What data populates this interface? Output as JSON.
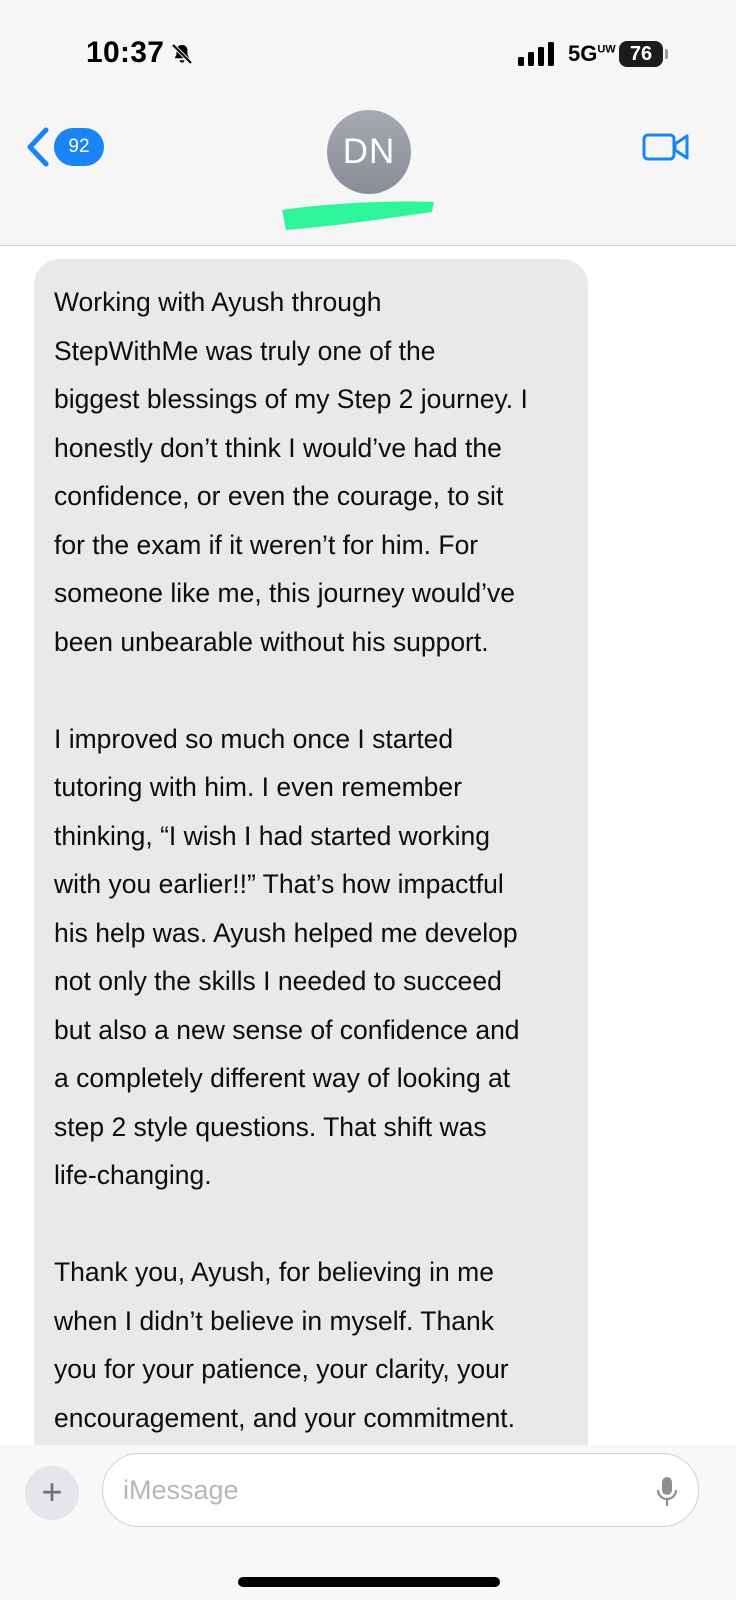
{
  "status_bar": {
    "time": "10:37",
    "network": "5G",
    "network_sup": "UW",
    "battery": "76"
  },
  "header": {
    "back_count": "92",
    "contact_initials": "DN"
  },
  "message": {
    "lines": [
      "Working with Ayush through",
      "StepWithMe was truly one of the",
      "biggest blessings of my Step 2 journey. I",
      "honestly don’t think I would’ve had the",
      "confidence, or even the courage, to sit",
      "for the exam if it weren’t for him. For",
      "someone like me, this journey would’ve",
      "been unbearable without his support.",
      "",
      "I improved so much once I started",
      "tutoring with him. I even remember",
      "thinking, “I wish I had started working",
      "with you earlier!!” That’s how impactful",
      "his help was. Ayush helped me develop",
      "not only the skills I needed to succeed",
      "but also a new sense of confidence and",
      "a completely different way of looking at",
      "step 2 style questions. That shift was",
      "life-changing.",
      "",
      "Thank you, Ayush, for believing in me",
      "when I didn’t believe in myself. Thank",
      "you for your patience, your clarity, your",
      "encouragement, and your commitment."
    ]
  },
  "compose": {
    "plus": "+",
    "placeholder": "iMessage"
  },
  "icons": {
    "silent": "bell-slash-icon",
    "back": "chevron-left-icon",
    "video": "video-camera-icon",
    "mic": "microphone-icon"
  },
  "colors": {
    "accent": "#1a84f6",
    "bubble": "#e9e9eb",
    "redaction": "#2ef59a"
  }
}
